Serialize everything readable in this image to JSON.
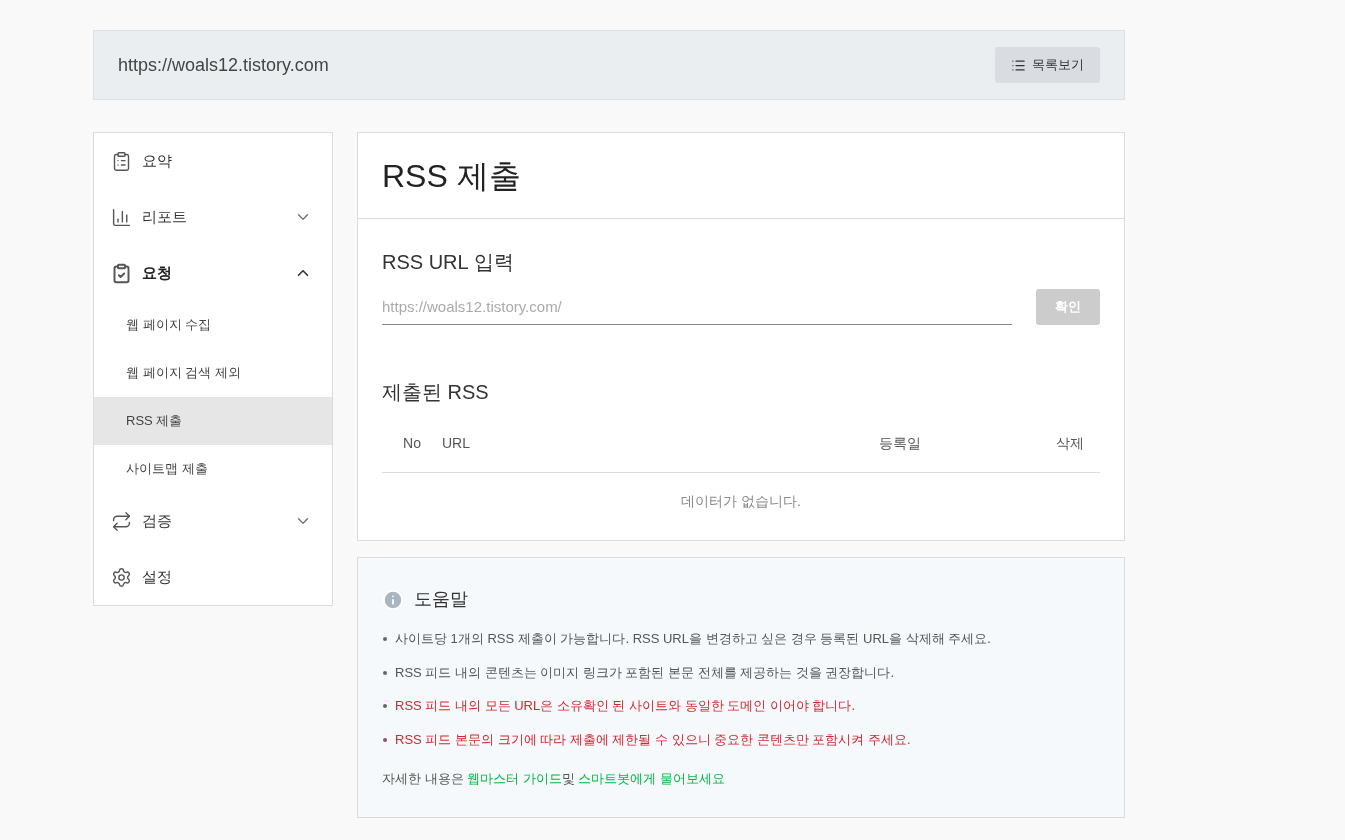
{
  "header": {
    "site_url": "https://woals12.tistory.com",
    "list_button": "목록보기"
  },
  "sidebar": {
    "items": [
      {
        "label": "요약",
        "kind": "link"
      },
      {
        "label": "리포트",
        "kind": "group",
        "expanded": false
      },
      {
        "label": "요청",
        "kind": "group",
        "expanded": true,
        "children": [
          {
            "label": "웹 페이지 수집",
            "selected": false
          },
          {
            "label": "웹 페이지 검색 제외",
            "selected": false
          },
          {
            "label": "RSS 제출",
            "selected": true
          },
          {
            "label": "사이트맵 제출",
            "selected": false
          }
        ]
      },
      {
        "label": "검증",
        "kind": "group",
        "expanded": false
      },
      {
        "label": "설정",
        "kind": "link"
      }
    ]
  },
  "main": {
    "title": "RSS 제출",
    "input_section": {
      "heading": "RSS URL 입력",
      "placeholder": "https://woals12.tistory.com/",
      "submit": {
        "label": "확인",
        "disabled": true
      }
    },
    "submitted": {
      "heading": "제출된 RSS",
      "columns": [
        "No",
        "URL",
        "등록일",
        "삭제"
      ],
      "empty_message": "데이터가 없습니다."
    }
  },
  "help": {
    "title": "도움말",
    "notes": [
      {
        "text": "사이트당 1개의 RSS 제출이 가능합니다. RSS URL을 변경하고 싶은 경우 등록된 URL을 삭제해 주세요.",
        "kind": "normal"
      },
      {
        "text": "RSS 피드 내의 콘텐츠는 이미지 링크가 포함된 본문 전체를 제공하는 것을 권장합니다.",
        "kind": "normal"
      },
      {
        "text": "RSS 피드 내의 모든 URL은 소유확인 된 사이트와 동일한 도메인 이어야 합니다.",
        "kind": "warning"
      },
      {
        "text": "RSS 피드 본문의 크기에 따라 제출에 제한될 수 있으니 중요한 콘텐츠만 포함시켜 주세요.",
        "kind": "warning"
      }
    ],
    "footer": [
      {
        "text": "자세한 내용은 ",
        "kind": "text"
      },
      {
        "text": "웹마스터 가이드",
        "kind": "link"
      },
      {
        "text": "및 ",
        "kind": "text"
      },
      {
        "text": "스마트봇에게 물어보세요",
        "kind": "link"
      }
    ]
  }
}
